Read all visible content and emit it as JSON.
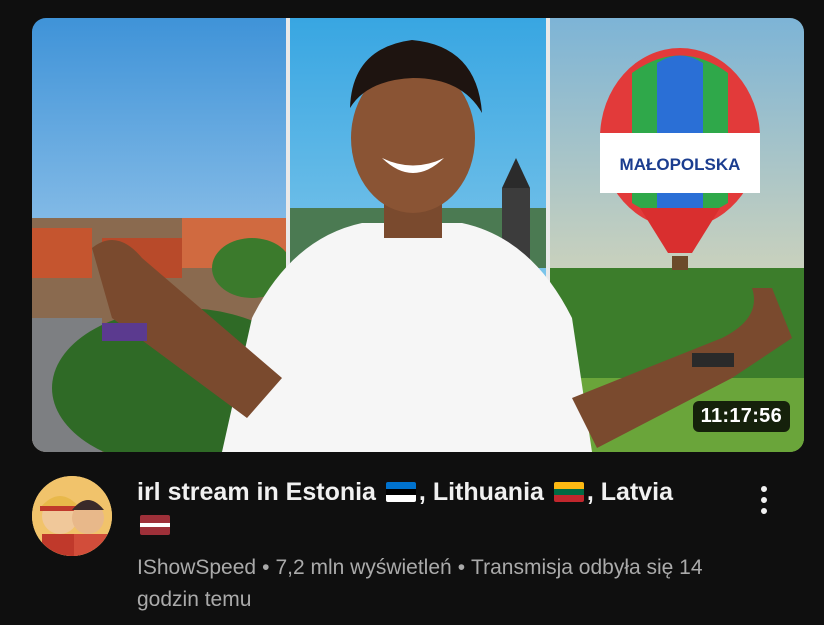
{
  "video": {
    "duration": "11:17:56",
    "balloon_text": "MAŁOPOLSKA",
    "title_parts": [
      "irl stream in Estonia",
      ", Lithuania",
      ", Latvia"
    ],
    "flags": [
      "estonia-flag-icon",
      "lithuania-flag-icon",
      "latvia-flag-icon"
    ]
  },
  "channel": {
    "name": "IShowSpeed"
  },
  "meta": {
    "views": "7,2 mln wyświetleń",
    "streamed": "Transmisja odbyła się 14 godzin temu",
    "separator": "•"
  },
  "colors": {
    "background": "#0f0f0f",
    "title": "#f1f1f1",
    "meta": "#aaaaaa",
    "estonia": [
      "#0072ce",
      "#000000",
      "#ffffff"
    ],
    "lithuania": [
      "#fdb913",
      "#006a44",
      "#c1272d"
    ],
    "latvia": [
      "#9e3039",
      "#ffffff",
      "#9e3039"
    ]
  }
}
